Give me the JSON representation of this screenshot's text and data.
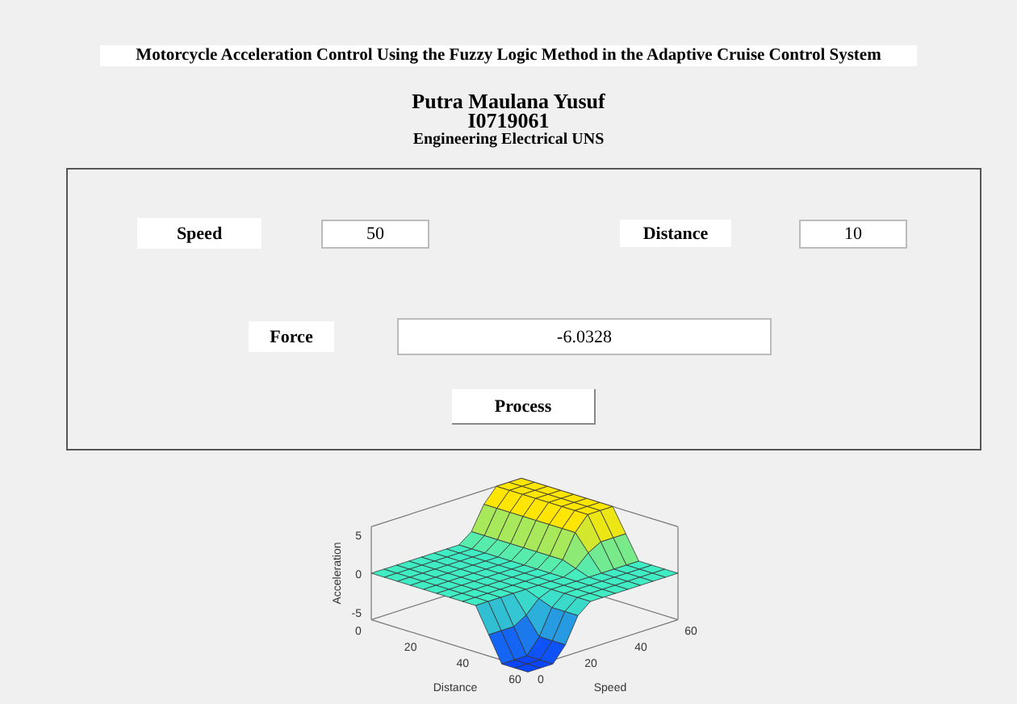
{
  "title": "Motorcycle Acceleration Control Using the Fuzzy Logic Method in the Adaptive Cruise Control System",
  "author": {
    "name": "Putra Maulana Yusuf",
    "id": "I0719061",
    "affiliation": "Engineering Electrical UNS"
  },
  "inputs": [
    {
      "label": "Speed",
      "value": "50"
    },
    {
      "label": "Distance",
      "value": "10"
    }
  ],
  "output": {
    "label": "Force",
    "value": "-6.0328"
  },
  "button": "Process",
  "plot": {
    "zlabel": "Acceleration",
    "xlabel": "Distance",
    "ylabel": "Speed",
    "zticks": [
      "5",
      "0",
      "-5"
    ],
    "xticks": [
      "0",
      "20",
      "40",
      "60"
    ],
    "yticks": [
      "0",
      "20",
      "40",
      "60"
    ]
  }
}
